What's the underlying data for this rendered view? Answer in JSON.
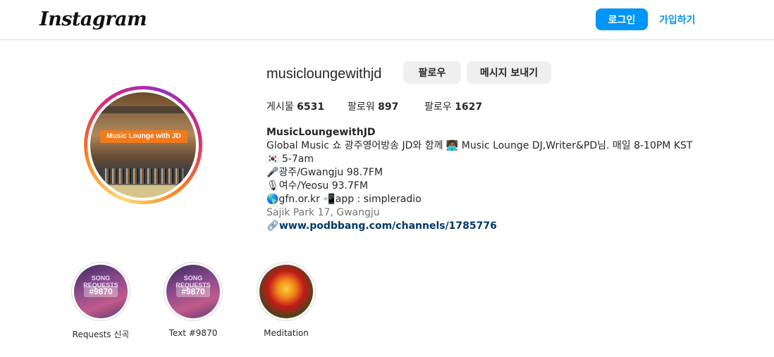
{
  "nav": {
    "logo": "Instagram",
    "login_label": "로그인",
    "signup_label": "가입하기"
  },
  "profile": {
    "username": "musicloungewithjd",
    "follow_label": "팔로우",
    "message_label": "메시지 보내기",
    "avatar_banner": "Music Lounge with JD",
    "stats": {
      "posts_label": "게시물",
      "posts_value": "6531",
      "followers_label": "팔로워",
      "followers_value": "897",
      "following_label": "팔로우",
      "following_value": "1627"
    },
    "bio": {
      "name": "MusicLoungewithJD",
      "line1": "Global Music 쇼 광주영어방송 JD와 함께 🧑🏾‍💻 Music Lounge DJ,Writer&PD님. 매일 8-10PM KST🇰🇷 5-7am",
      "line2": "🎤광주/Gwangju 98.7FM",
      "line3": "🎙여수/Yeosu 93.7FM",
      "line4": "🌎gfn.or.kr 📲app : simpleradio",
      "location": "Sajik Park 17, Gwangju",
      "link": "www.podbbang.com/channels/1785776"
    }
  },
  "highlights": [
    {
      "label": "Requests 신곡",
      "cover_text": "SONG REQUESTS",
      "cover_number": "#9870"
    },
    {
      "label": "Text #9870",
      "cover_text": "SONG REQUESTS",
      "cover_number": "#9870"
    },
    {
      "label": "Meditation"
    }
  ],
  "colors": {
    "accent": "#0095f6",
    "link": "#00376b",
    "button_gray": "#efefef",
    "muted": "#737373"
  }
}
